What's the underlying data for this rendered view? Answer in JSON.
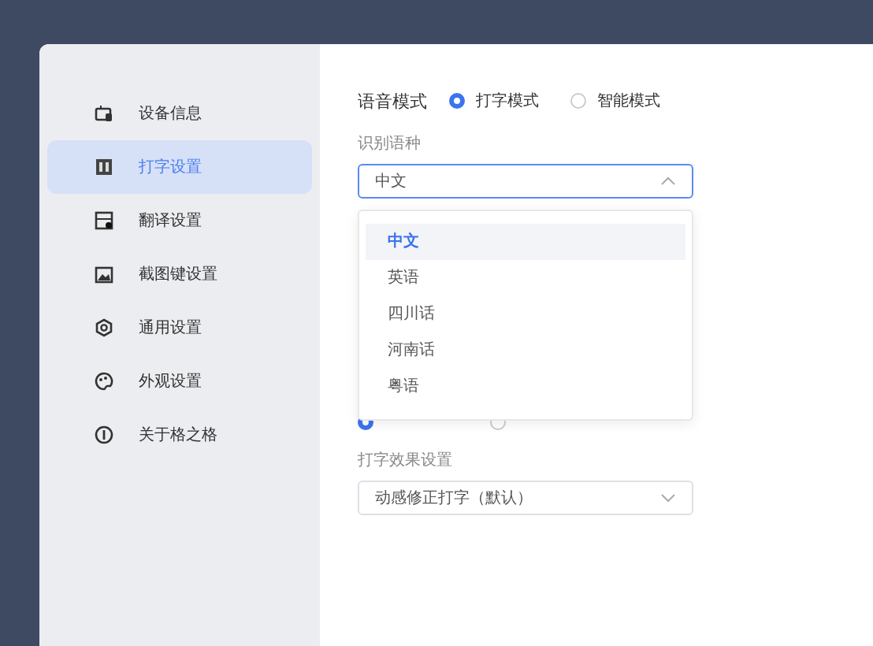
{
  "sidebar": {
    "items": [
      {
        "label": "设备信息",
        "selected": false
      },
      {
        "label": "打字设置",
        "selected": true
      },
      {
        "label": "翻译设置",
        "selected": false
      },
      {
        "label": "截图键设置",
        "selected": false
      },
      {
        "label": "通用设置",
        "selected": false
      },
      {
        "label": "外观设置",
        "selected": false
      },
      {
        "label": "关于格之格",
        "selected": false
      }
    ]
  },
  "voice_mode": {
    "label": "语音模式",
    "options": [
      {
        "label": "打字模式",
        "selected": true
      },
      {
        "label": "智能模式",
        "selected": false
      }
    ]
  },
  "language": {
    "label": "识别语种",
    "value": "中文",
    "expanded": true,
    "options": [
      {
        "label": "中文",
        "selected": true
      },
      {
        "label": "英语",
        "selected": false
      },
      {
        "label": "四川话",
        "selected": false
      },
      {
        "label": "河南话",
        "selected": false
      },
      {
        "label": "粤语",
        "selected": false
      }
    ]
  },
  "display_radios": [
    {
      "selected": true
    },
    {
      "selected": false
    }
  ],
  "typing_effect": {
    "label": "打字效果设置",
    "value": "动感修正打字（默认）"
  }
}
